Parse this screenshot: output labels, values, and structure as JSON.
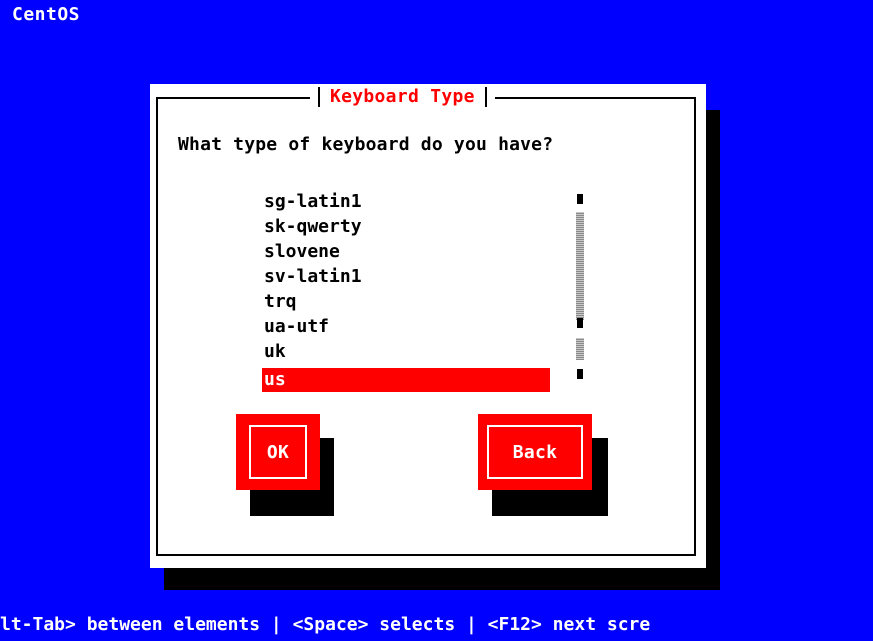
{
  "os": {
    "title": "CentOS"
  },
  "dialog": {
    "title": "Keyboard Type",
    "question": "What type of keyboard do you have?",
    "items": [
      "sg-latin1",
      "sk-qwerty",
      "slovene",
      "sv-latin1",
      "trq",
      "ua-utf",
      "uk",
      "us"
    ],
    "selected_item": "us",
    "buttons": {
      "ok": "OK",
      "back": "Back"
    }
  },
  "status": {
    "hint": "lt-Tab> between elements  | <Space> selects | <F12> next scre"
  },
  "colors": {
    "background": "#0000ff",
    "dialog": "#ffffff",
    "accent": "#ff0000",
    "shadow": "#000000"
  }
}
